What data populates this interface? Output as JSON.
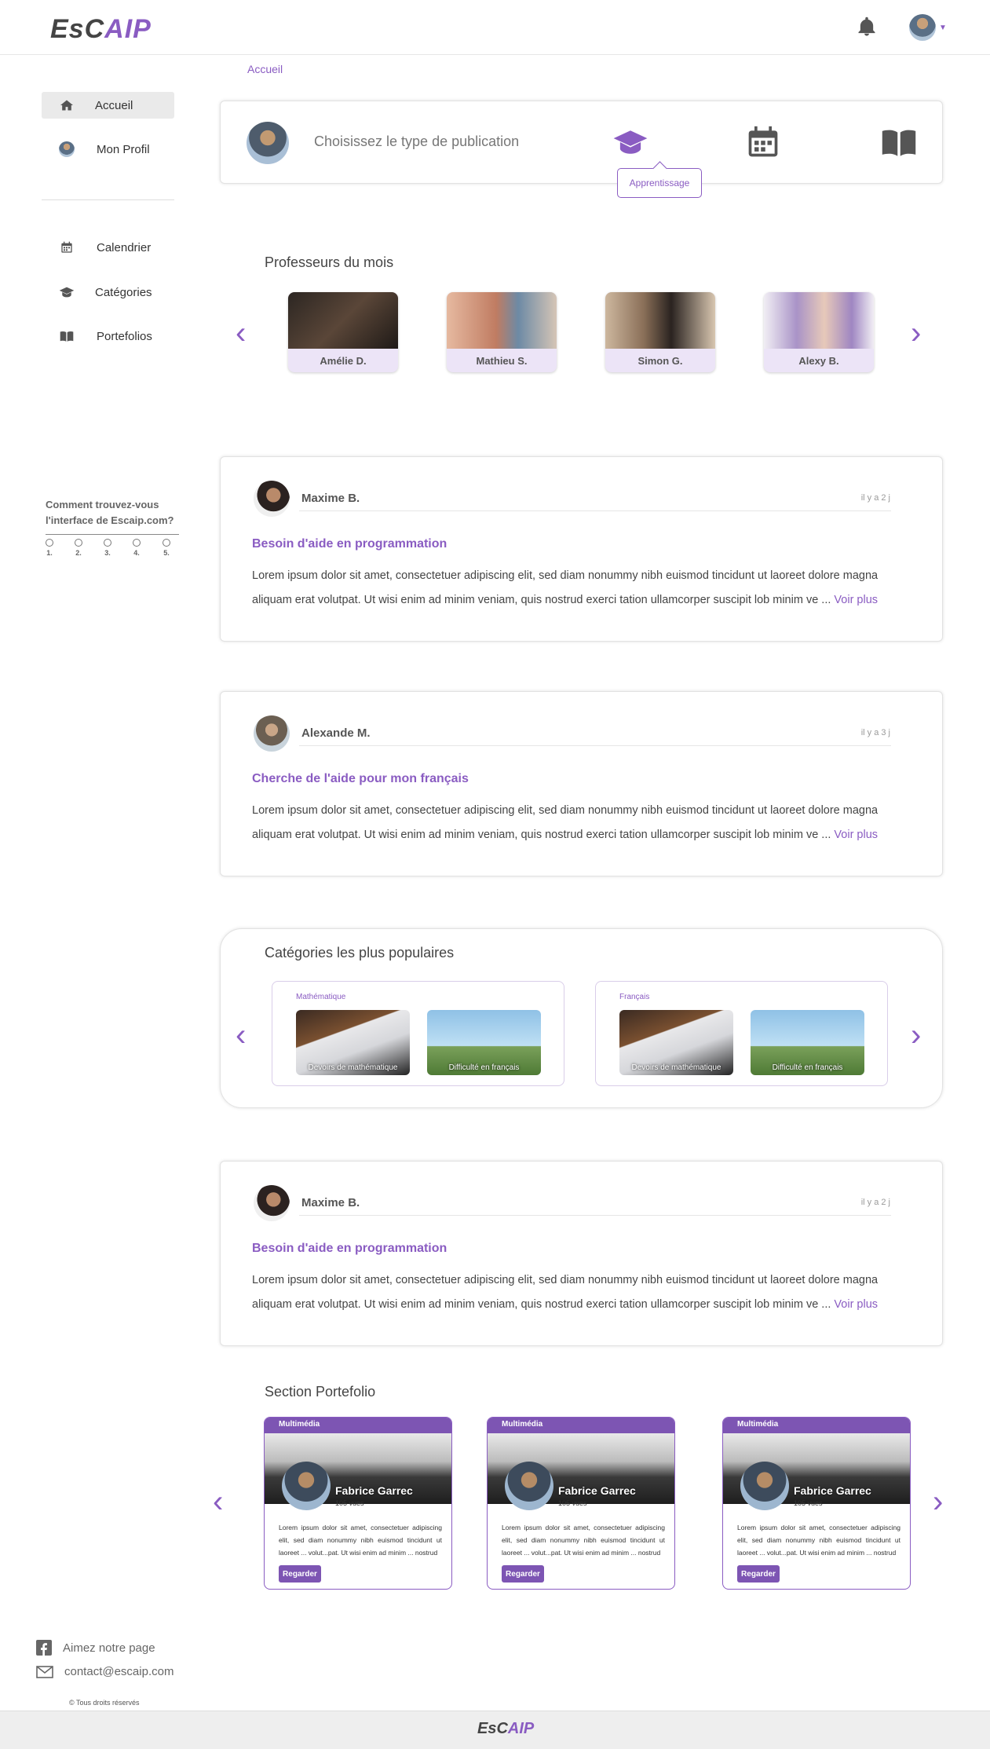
{
  "header": {
    "logo_part1": "EsC",
    "logo_part2": "AIP"
  },
  "sidebar": {
    "items": [
      {
        "label": "Accueil",
        "icon": "home-icon"
      },
      {
        "label": "Mon Profil",
        "icon": "avatar"
      },
      {
        "label": "Calendrier",
        "icon": "calendar-icon"
      },
      {
        "label": "Catégories",
        "icon": "graduation-cap-icon"
      },
      {
        "label": "Portefolios",
        "icon": "book-icon"
      }
    ]
  },
  "survey": {
    "question": "Comment trouvez-vous l'interface de Escaip.com?",
    "options": [
      "1.",
      "2.",
      "3.",
      "4.",
      "5."
    ]
  },
  "breadcrumb": "Accueil",
  "publish": {
    "prompt": "Choisissez le type de publication",
    "tooltip": "Apprentissage"
  },
  "professors": {
    "title": "Professeurs du mois",
    "items": [
      "Amélie D.",
      "Mathieu S.",
      "Simon G.",
      "Alexy B."
    ]
  },
  "posts": [
    {
      "author": "Maxime B.",
      "time": "il y a 2 j",
      "title": "Besoin d'aide en programmation",
      "body": "Lorem ipsum dolor sit amet, consectetuer adipiscing elit, sed diam nonummy nibh euismod tincidunt ut laoreet dolore magna aliquam erat volutpat. Ut wisi enim ad minim veniam, quis nostrud exerci tation ullamcorper suscipit lob minim ve ...",
      "more": "Voir plus"
    },
    {
      "author": "Alexande  M.",
      "time": "il y a 3 j",
      "title": "Cherche de l'aide pour mon français",
      "body": "Lorem ipsum dolor sit amet, consectetuer adipiscing elit, sed diam nonummy nibh euismod tincidunt ut laoreet dolore magna aliquam erat volutpat. Ut wisi enim ad minim veniam, quis nostrud exerci tation ullamcorper suscipit lob minim ve ...",
      "more": "Voir plus"
    },
    {
      "author": "Maxime B.",
      "time": "il y a 2 j",
      "title": "Besoin d'aide en programmation",
      "body": "Lorem ipsum dolor sit amet, consectetuer adipiscing elit, sed diam nonummy nibh euismod tincidunt ut laoreet dolore magna aliquam erat volutpat. Ut wisi enim ad minim veniam, quis nostrud exerci tation ullamcorper suscipit lob minim ve ...",
      "more": "Voir plus"
    }
  ],
  "categories": {
    "title": "Catégories les plus populaires",
    "groups": [
      {
        "label": "Mathématique",
        "items": [
          "Devoirs de mathématique",
          "Difficulté en français"
        ]
      },
      {
        "label": "Français",
        "items": [
          "Devoirs de mathématique",
          "Difficulté en français"
        ]
      }
    ]
  },
  "portfolio": {
    "title": "Section Portefolio",
    "items": [
      {
        "tag": "Multimédia",
        "name": "Fabrice Garrec",
        "views": "105 vues",
        "text": "Lorem ipsum dolor sit amet, consectetuer adipiscing elit, sed diam nonummy nibh euismod tincidunt ut laoreet ... volut...pat. Ut wisi enim ad minim ... nostrud",
        "button": "Regarder"
      },
      {
        "tag": "Multimédia",
        "name": "Fabrice Garrec",
        "views": "105 vues",
        "text": "Lorem ipsum dolor sit amet, consectetuer adipiscing elit, sed diam nonummy nibh euismod tincidunt ut laoreet ... volut...pat. Ut wisi enim ad minim ... nostrud",
        "button": "Regarder"
      },
      {
        "tag": "Multimédia",
        "name": "Fabrice Garrec",
        "views": "105 vues",
        "text": "Lorem ipsum dolor sit amet, consectetuer adipiscing elit, sed diam nonummy nibh euismod tincidunt ut laoreet ... volut...pat. Ut wisi enim ad minim ... nostrud",
        "button": "Regarder"
      }
    ]
  },
  "footer": {
    "like": "Aimez notre page",
    "email": "contact@escaip.com",
    "rights": "Tous droits réservés"
  },
  "colors": {
    "accent": "#8a5cc2",
    "portfolio_bar": "#7d55b3"
  }
}
